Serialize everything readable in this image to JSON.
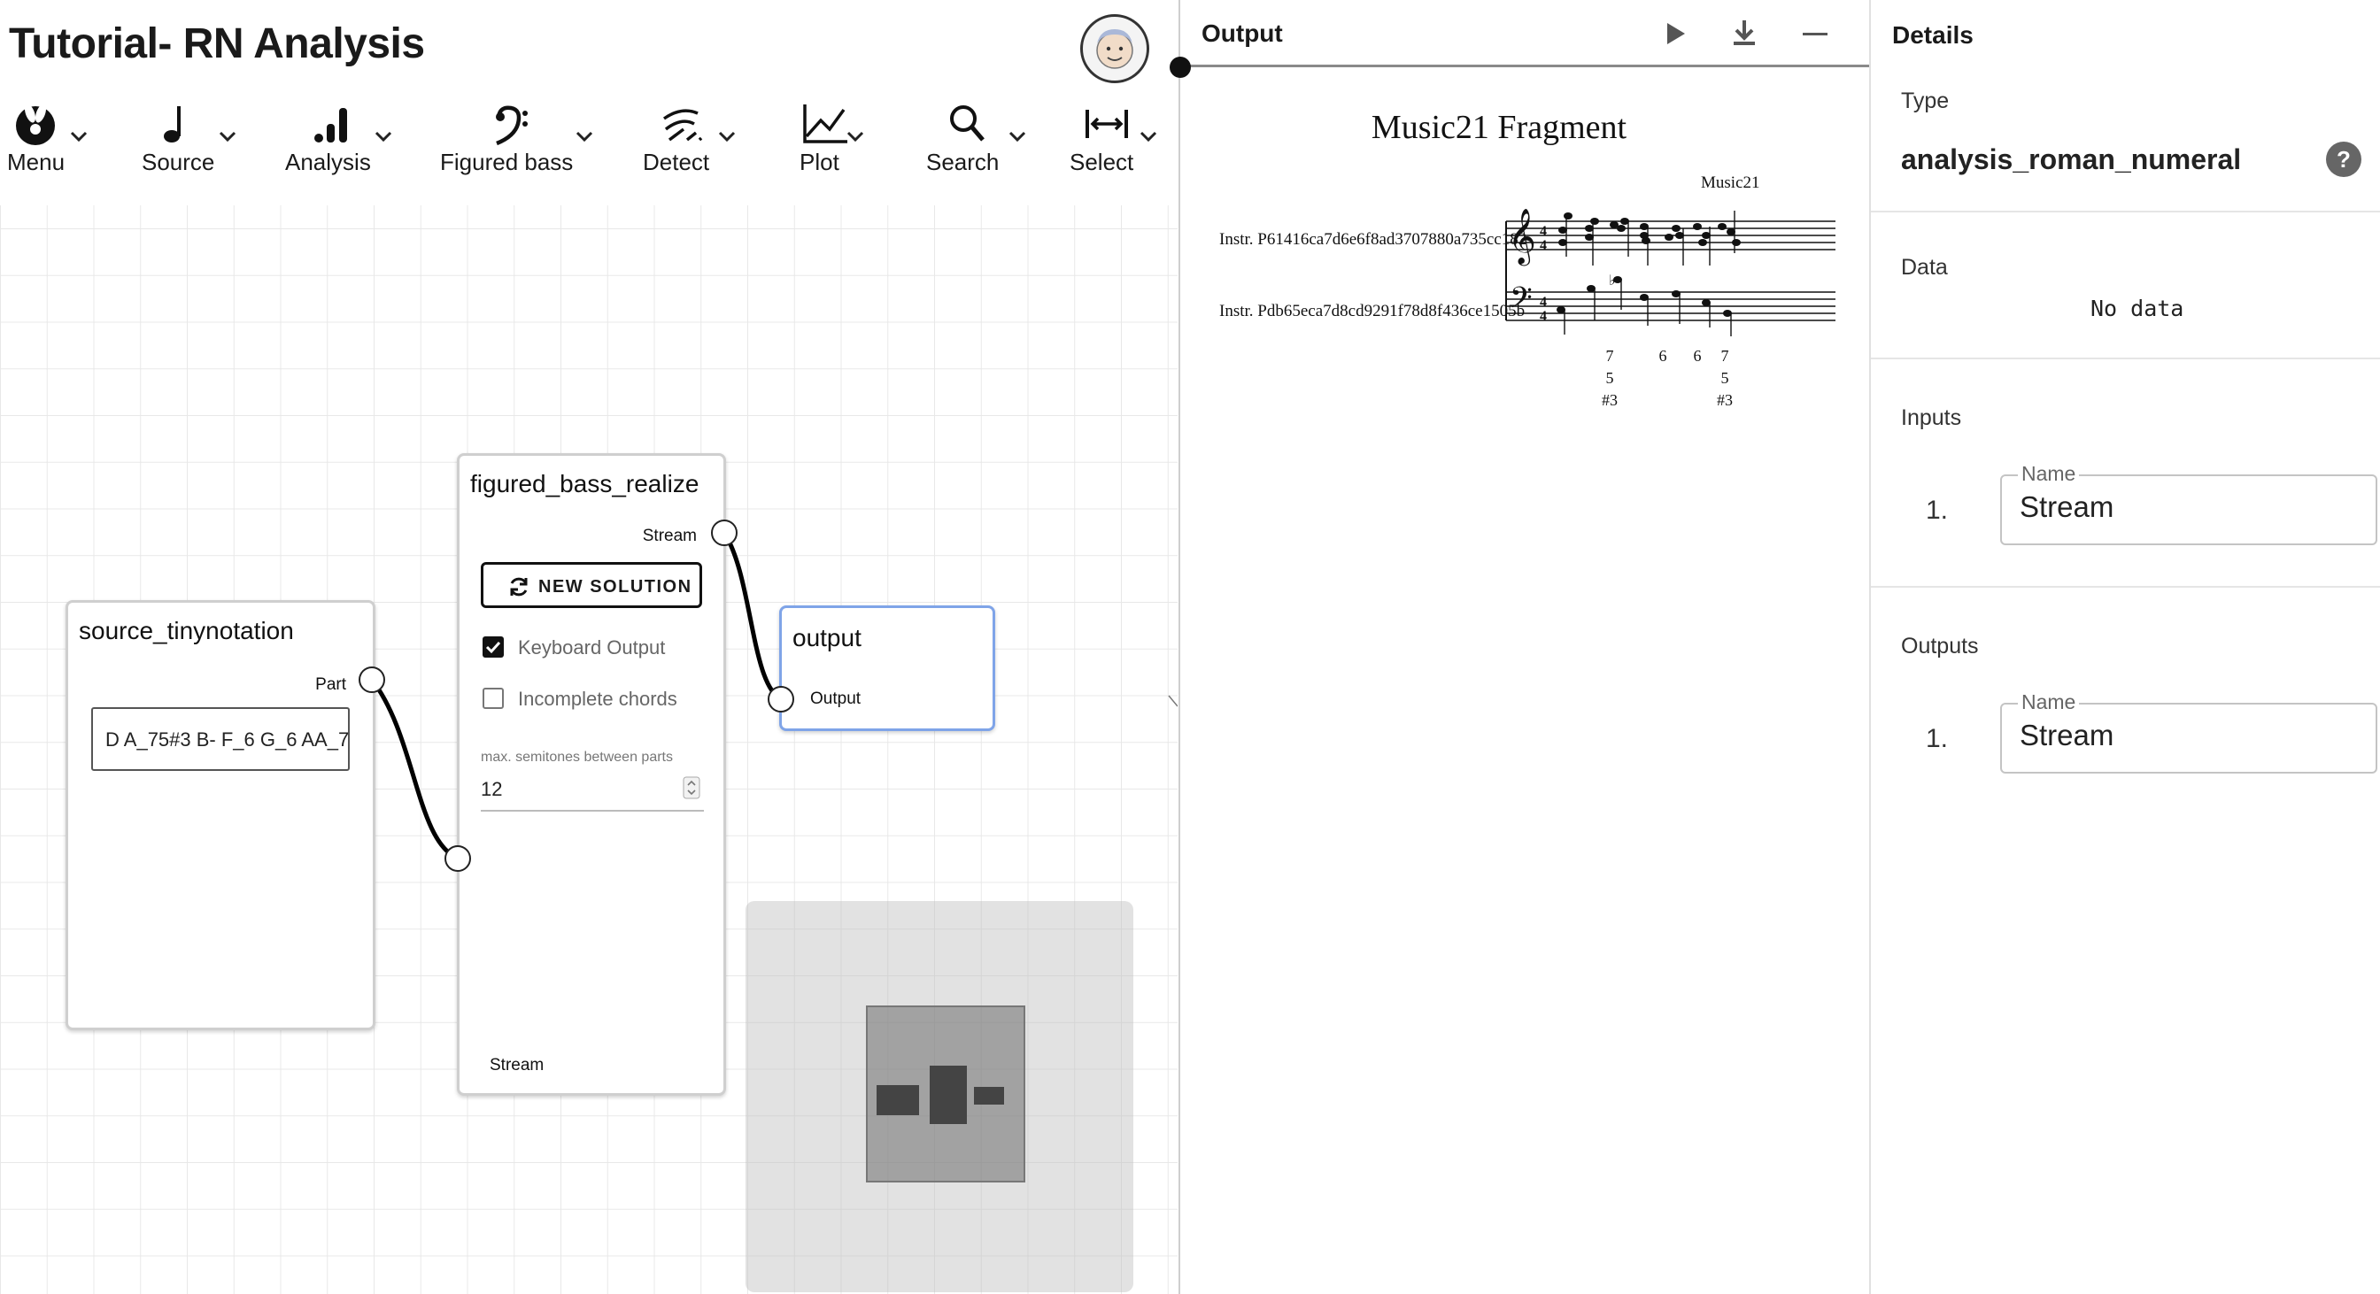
{
  "app": {
    "title": "Tutorial- RN Analysis"
  },
  "toolbar": {
    "items": [
      {
        "label": "Menu",
        "icon": "menu-app-icon"
      },
      {
        "label": "Source",
        "icon": "music-note-icon"
      },
      {
        "label": "Analysis",
        "icon": "bar-chart-icon"
      },
      {
        "label": "Figured bass",
        "icon": "bass-clef-icon"
      },
      {
        "label": "Detect",
        "icon": "signal-detect-icon"
      },
      {
        "label": "Plot",
        "icon": "line-chart-icon"
      },
      {
        "label": "Search",
        "icon": "search-icon"
      },
      {
        "label": "Select",
        "icon": "select-range-icon"
      }
    ]
  },
  "nodes": {
    "source": {
      "title": "source_tinynotation",
      "out_port": "Part",
      "input_value": "D A_75#3 B- F_6 G_6 AA_7"
    },
    "figured": {
      "title": "figured_bass_realize",
      "out_port": "Stream",
      "button": "NEW SOLUTION",
      "keyboard_output": "Keyboard Output",
      "keyboard_checked": true,
      "incomplete_chords": "Incomplete chords",
      "incomplete_checked": false,
      "semitones_label": "max. semitones between parts",
      "semitones_value": "12",
      "in_port": "Stream"
    },
    "output": {
      "title": "output",
      "in_port": "Output"
    }
  },
  "output_panel": {
    "heading": "Output",
    "score_title": "Music21 Fragment",
    "composer": "Music21",
    "part1": "Instr. P61416ca7d6e6f8ad3707880a735cc182",
    "part2": "Instr. Pdb65eca7d8cd9291f78d8f436ce1505b",
    "figures": [
      {
        "lines": [
          "7",
          "5",
          "#3"
        ]
      },
      {
        "lines": [
          "6"
        ]
      },
      {
        "lines": [
          "6"
        ]
      },
      {
        "lines": [
          "7",
          "5",
          "#3"
        ]
      }
    ]
  },
  "details": {
    "heading": "Details",
    "type_label": "Type",
    "type_value": "analysis_roman_numeral",
    "data_label": "Data",
    "data_value": "No data",
    "inputs_label": "Inputs",
    "outputs_label": "Outputs",
    "name_legend": "Name",
    "inputs": [
      {
        "index": "1.",
        "name": "Stream"
      }
    ],
    "outputs": [
      {
        "index": "1.",
        "name": "Stream"
      }
    ]
  }
}
